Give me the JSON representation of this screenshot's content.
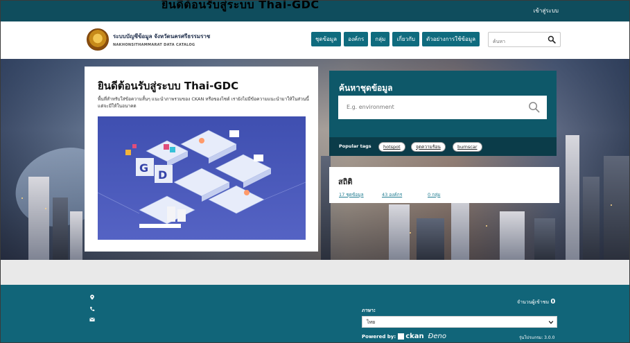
{
  "overlay_title": "ยินดีต้อนรับสู่ระบบ Thai-GDC",
  "topbar": {
    "login": "เข้าสู่ระบบ"
  },
  "brand": {
    "name_th": "ระบบบัญชีข้อมูล จังหวัดนครศรีธรรมราช",
    "name_en": "NAKHONSITHAMMARAT DATA CATALOG"
  },
  "nav": {
    "items": [
      "ชุดข้อมูล",
      "องค์กร",
      "กลุ่ม",
      "เกี่ยวกับ",
      "ตัวอย่างการใช้ข้อมูล"
    ]
  },
  "header_search": {
    "placeholder": "ค้นหา"
  },
  "welcome": {
    "title": "ยินดีต้อนรับสู่ระบบ Thai-GDC",
    "body": "พื้นที่สำหรับใส่ข้อความสั้นๆ แนะนำภาพรวมของ CKAN หรือของไซต์ เรายังไม่มีข้อความแนะนำมาให้ในส่วนนี้ แต่จะมีให้ในอนาคต",
    "illustration_label": "GDC catalog illustration"
  },
  "dataset_search": {
    "title": "ค้นหาชุดข้อมูล",
    "placeholder": "E.g. environment",
    "popular_tags_label": "Popular tags",
    "tags": [
      "hotspot",
      "จุดความร้อน",
      "burnscar"
    ]
  },
  "stats": {
    "title": "สถิติ",
    "items": [
      "17 ชุดข้อมูล",
      "43 องค์กร",
      "0 กลุ่ม"
    ]
  },
  "footer": {
    "visitors_label": "จำนวนผู้เข้าชม",
    "visitors_count": "0",
    "language_label": "ภาษา:",
    "language_value": "ไทย",
    "powered_by": "Powered by:",
    "ckan": "ckan",
    "dev": "Ɖeno",
    "version": "รุ่นโปรแกรม: 3.0.0",
    "icons": [
      "map-marker-icon",
      "phone-icon",
      "envelope-icon"
    ]
  },
  "colors": {
    "topbar": "#0f4d5d",
    "nav_button": "#0f6b7e",
    "search_panel": "#0e5869",
    "footer": "#116579"
  }
}
